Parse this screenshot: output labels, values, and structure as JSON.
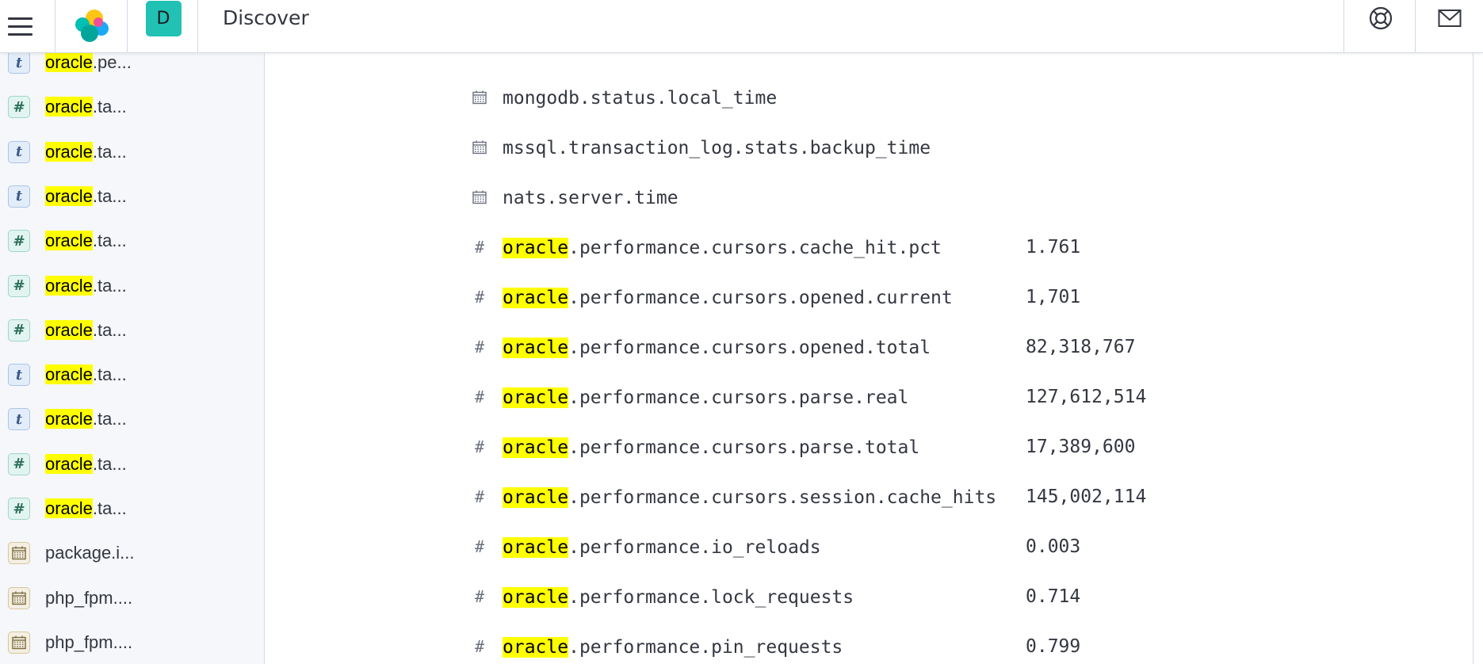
{
  "header": {
    "title": "Discover",
    "space_initial": "D",
    "icons": {
      "menu": "hamburger-menu-icon",
      "logo": "elastic-logo",
      "help": "help-lifebuoy-icon",
      "news": "newsfeed-mail-icon"
    }
  },
  "sidebar": {
    "items": [
      {
        "type": "string",
        "highlight": "oracle",
        "rest": ".pe..."
      },
      {
        "type": "number",
        "highlight": "oracle",
        "rest": ".ta..."
      },
      {
        "type": "string",
        "highlight": "oracle",
        "rest": ".ta..."
      },
      {
        "type": "string",
        "highlight": "oracle",
        "rest": ".ta..."
      },
      {
        "type": "number",
        "highlight": "oracle",
        "rest": ".ta..."
      },
      {
        "type": "number",
        "highlight": "oracle",
        "rest": ".ta..."
      },
      {
        "type": "number",
        "highlight": "oracle",
        "rest": ".ta..."
      },
      {
        "type": "string",
        "highlight": "oracle",
        "rest": ".ta..."
      },
      {
        "type": "string",
        "highlight": "oracle",
        "rest": ".ta..."
      },
      {
        "type": "number",
        "highlight": "oracle",
        "rest": ".ta..."
      },
      {
        "type": "number",
        "highlight": "oracle",
        "rest": ".ta..."
      },
      {
        "type": "date",
        "highlight": "",
        "rest": "package.i..."
      },
      {
        "type": "date",
        "highlight": "",
        "rest": "php_fpm...."
      },
      {
        "type": "date",
        "highlight": "",
        "rest": "php_fpm...."
      }
    ],
    "type_glyphs": {
      "string": "t",
      "number": "#"
    }
  },
  "doc": {
    "rows": [
      {
        "type": "date",
        "highlight": "",
        "rest": "mongodb.status.local_time",
        "value": ""
      },
      {
        "type": "date",
        "highlight": "",
        "rest": "mssql.transaction_log.stats.backup_time",
        "value": ""
      },
      {
        "type": "date",
        "highlight": "",
        "rest": "nats.server.time",
        "value": ""
      },
      {
        "type": "number",
        "highlight": "oracle",
        "rest": ".performance.cursors.cache_hit.pct",
        "value": "1.761"
      },
      {
        "type": "number",
        "highlight": "oracle",
        "rest": ".performance.cursors.opened.current",
        "value": "1,701"
      },
      {
        "type": "number",
        "highlight": "oracle",
        "rest": ".performance.cursors.opened.total",
        "value": "82,318,767"
      },
      {
        "type": "number",
        "highlight": "oracle",
        "rest": ".performance.cursors.parse.real",
        "value": "127,612,514"
      },
      {
        "type": "number",
        "highlight": "oracle",
        "rest": ".performance.cursors.parse.total",
        "value": "17,389,600"
      },
      {
        "type": "number",
        "highlight": "oracle",
        "rest": ".performance.cursors.session.cache_hits",
        "value": "145,002,114"
      },
      {
        "type": "number",
        "highlight": "oracle",
        "rest": ".performance.io_reloads",
        "value": "0.003"
      },
      {
        "type": "number",
        "highlight": "oracle",
        "rest": ".performance.lock_requests",
        "value": "0.714"
      },
      {
        "type": "number",
        "highlight": "oracle",
        "rest": ".performance.pin_requests",
        "value": "0.799"
      }
    ],
    "number_glyph": "#"
  },
  "colors": {
    "highlight": "#ffff00",
    "avatar": "#21c1b4",
    "border": "#d3dae6",
    "sidebar_bg": "#f5f7fa"
  }
}
